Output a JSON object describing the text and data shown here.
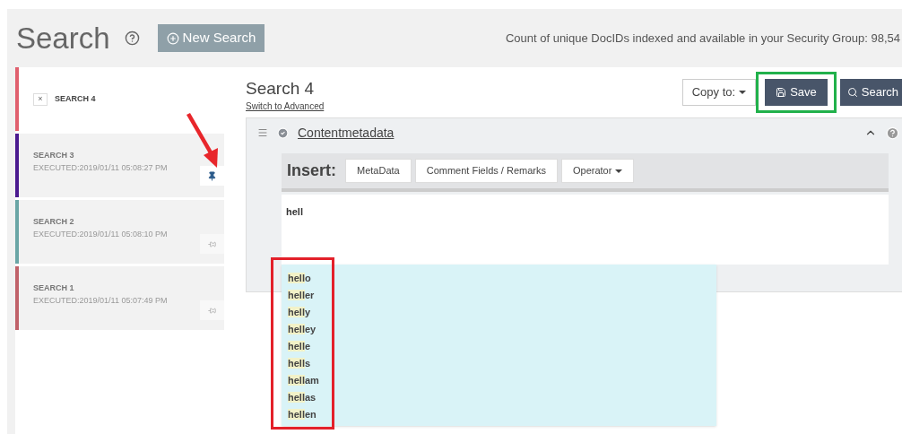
{
  "header": {
    "title": "Search",
    "new_search_label": "New Search",
    "count_text": "Count of unique DocIDs indexed and available in your Security Group: 98,54"
  },
  "history": [
    {
      "title": "SEARCH 4",
      "color": "#e0606e",
      "selected": true,
      "close": "×"
    },
    {
      "title": "SEARCH 3",
      "executed": "EXECUTED:2019/01/11 05:08:27 PM",
      "color": "#4b1a8f",
      "selected": false,
      "pinned": true,
      "annotation": {
        "kind": "arrow",
        "color": "#e8262b"
      }
    },
    {
      "title": "SEARCH 2",
      "executed": "EXECUTED:2019/01/11 05:08:10 PM",
      "color": "#6aa5a5",
      "selected": false,
      "pinned": false
    },
    {
      "title": "SEARCH 1",
      "executed": "EXECUTED:2019/01/11 05:07:49 PM",
      "color": "#c0626a",
      "selected": false,
      "pinned": false
    }
  ],
  "main": {
    "title": "Search 4",
    "switch_link": "Switch to Advanced",
    "copy_label": "Copy to:",
    "save_label": "Save",
    "save_annotation": {
      "kind": "frame",
      "color": "#21b14b"
    },
    "search_label": "Search"
  },
  "panel": {
    "field_name": "Contentmetadata",
    "insert_label": "Insert:",
    "insert_buttons": [
      {
        "label": "MetaData",
        "dropdown": false
      },
      {
        "label": "Comment Fields / Remarks",
        "dropdown": false
      },
      {
        "label": "Operator",
        "dropdown": true
      }
    ],
    "query": "hell",
    "suggestions_annotation": {
      "kind": "frame",
      "color": "#e3202a"
    },
    "suggestions": [
      {
        "match": "hell",
        "rest": "o"
      },
      {
        "match": "hell",
        "rest": "er"
      },
      {
        "match": "hell",
        "rest": "y"
      },
      {
        "match": "hell",
        "rest": "ey"
      },
      {
        "match": "hell",
        "rest": "e"
      },
      {
        "match": "hell",
        "rest": "s"
      },
      {
        "match": "hell",
        "rest": "am"
      },
      {
        "match": "hell",
        "rest": "as"
      },
      {
        "match": "hell",
        "rest": "en"
      }
    ]
  }
}
